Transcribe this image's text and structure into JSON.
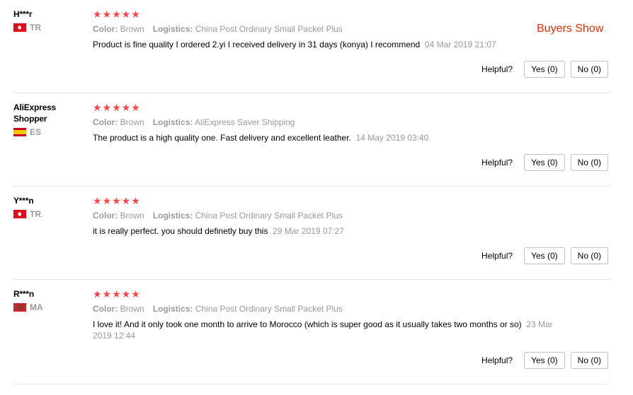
{
  "buyers_show": "Buyers Show",
  "helpful_label": "Helpful?",
  "reviews": [
    {
      "user": "H***r",
      "country": "TR",
      "flag": "flag-tr",
      "stars": "★★★★★",
      "color_label": "Color:",
      "color": "Brown",
      "logistics_label": "Logistics:",
      "logistics": "China Post Ordinary Small Packet Plus",
      "text": "Product is fine quality I ordered 2.yi I received delivery in 31 days (konya) I recommend",
      "date": "04 Mar 2019 21:07",
      "yes": "Yes (0)",
      "no": "No (0)"
    },
    {
      "user": "AliExpress Shopper",
      "country": "ES",
      "flag": "flag-es",
      "stars": "★★★★★",
      "color_label": "Color:",
      "color": "Brown",
      "logistics_label": "Logistics:",
      "logistics": "AliExpress Saver Shipping",
      "text": "The product is a high quality one. Fast delivery and excellent leather.",
      "date": "14 May 2019 03:40",
      "yes": "Yes (0)",
      "no": "No (0)"
    },
    {
      "user": "Y***n",
      "country": "TR",
      "flag": "flag-tr",
      "stars": "★★★★★",
      "color_label": "Color:",
      "color": "Brown",
      "logistics_label": "Logistics:",
      "logistics": "China Post Ordinary Small Packet Plus",
      "text": "it is really perfect. you should definetly buy this",
      "date": "29 Mar 2019 07:27",
      "yes": "Yes (0)",
      "no": "No (0)"
    },
    {
      "user": "R***n",
      "country": "MA",
      "flag": "flag-ma",
      "stars": "★★★★★",
      "color_label": "Color:",
      "color": "Brown",
      "logistics_label": "Logistics:",
      "logistics": "China Post Ordinary Small Packet Plus",
      "text": "I love it! And it only took one month to arrive to Morocco (which is super good as it usually takes two months or so)",
      "date": "23 Mar 2019 12:44",
      "yes": "Yes (0)",
      "no": "No (0)"
    }
  ]
}
